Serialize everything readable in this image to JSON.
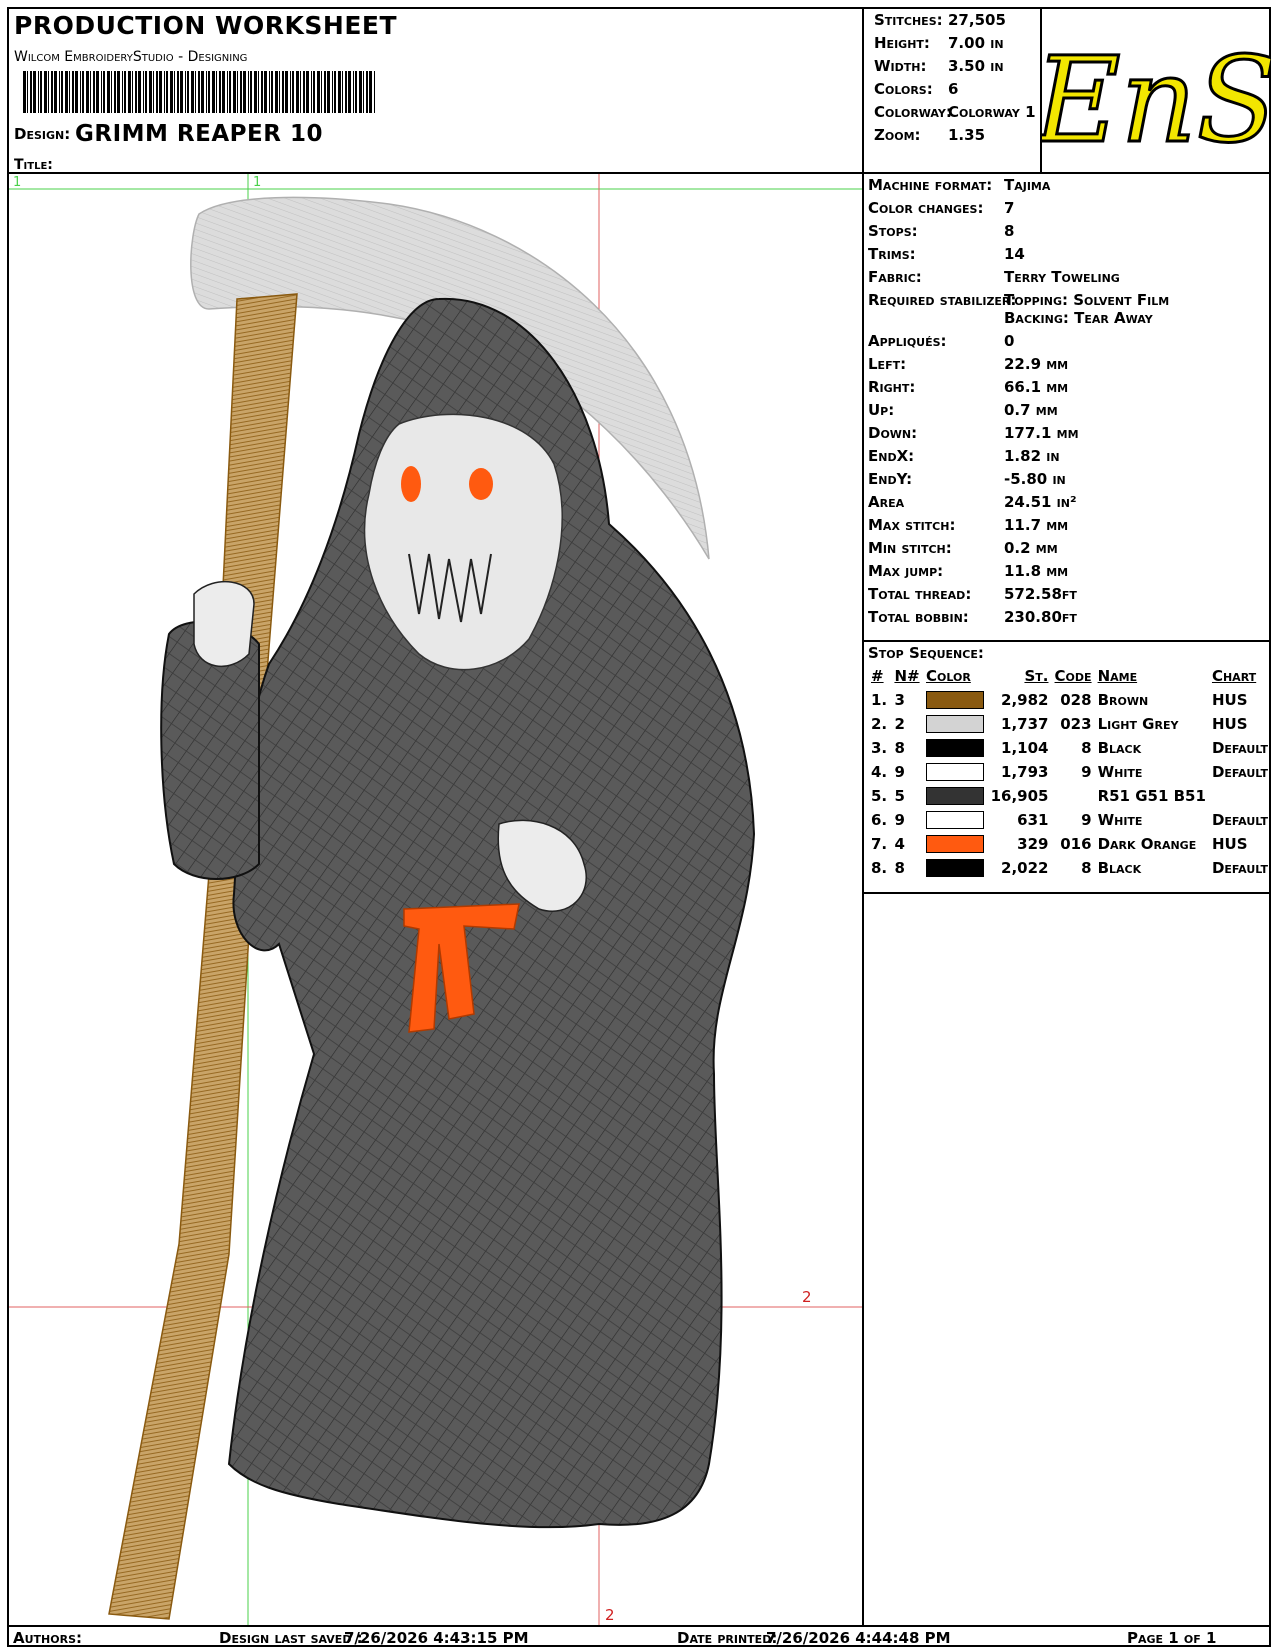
{
  "header": {
    "title": "PRODUCTION WORKSHEET",
    "subtitle": "Wilcom EmbroideryStudio - Designing",
    "design_label": "Design:",
    "design_value": "GRIMM REAPER  10",
    "title_label": "Title:"
  },
  "summary": {
    "stitches_label": "Stitches:",
    "stitches": "27,505",
    "height_label": "Height:",
    "height": "7.00 in",
    "width_label": "Width:",
    "width": "3.50 in",
    "colors_label": "Colors:",
    "colors": "6",
    "colorway_label": "Colorway:",
    "colorway": "Colorway 1",
    "zoom_label": "Zoom:",
    "zoom": "1.35"
  },
  "logo": {
    "text": "EnS",
    "color": "#f2e600"
  },
  "info": [
    {
      "label": "Machine format:",
      "value": "Tajima"
    },
    {
      "label": "Color changes:",
      "value": "7"
    },
    {
      "label": "Stops:",
      "value": "8"
    },
    {
      "label": "Trims:",
      "value": "14"
    },
    {
      "label": "Fabric:",
      "value": "Terry Toweling"
    },
    {
      "label": "Required stabilizer:",
      "value": "Topping: Solvent Film",
      "value2": "Backing: Tear Away"
    },
    {
      "label": "Appliqués:",
      "value": "0"
    },
    {
      "label": "Left:",
      "value": "22.9 mm"
    },
    {
      "label": "Right:",
      "value": "66.1 mm"
    },
    {
      "label": "Up:",
      "value": "0.7 mm"
    },
    {
      "label": "Down:",
      "value": "177.1 mm"
    },
    {
      "label": "EndX:",
      "value": "1.82 in"
    },
    {
      "label": "EndY:",
      "value": "-5.80 in"
    },
    {
      "label": "Area",
      "value": "24.51 in²"
    },
    {
      "label": "Max stitch:",
      "value": "11.7 mm"
    },
    {
      "label": "Min stitch:",
      "value": "0.2 mm"
    },
    {
      "label": "Max jump:",
      "value": "11.8 mm"
    },
    {
      "label": "Total thread:",
      "value": "572.58ft"
    },
    {
      "label": "Total bobbin:",
      "value": "230.80ft"
    }
  ],
  "stop_sequence": {
    "title": "Stop Sequence:",
    "headers": [
      "#",
      "N#",
      "Color",
      "St.",
      "Code",
      "Name",
      "Chart"
    ],
    "rows": [
      {
        "idx": "1.",
        "n": "3",
        "color": "#8a5a10",
        "st": "2,982",
        "code": "028",
        "name": "Brown",
        "chart": "HUS"
      },
      {
        "idx": "2.",
        "n": "2",
        "color": "#d3d3d3",
        "st": "1,737",
        "code": "023",
        "name": "Light Grey",
        "chart": "HUS"
      },
      {
        "idx": "3.",
        "n": "8",
        "color": "#000000",
        "st": "1,104",
        "code": "8",
        "name": "Black",
        "chart": "Default"
      },
      {
        "idx": "4.",
        "n": "9",
        "color": "#ffffff",
        "st": "1,793",
        "code": "9",
        "name": "White",
        "chart": "Default"
      },
      {
        "idx": "5.",
        "n": "5",
        "color": "#333333",
        "st": "16,905",
        "code": "",
        "name": "R51 G51 B51",
        "chart": ""
      },
      {
        "idx": "6.",
        "n": "9",
        "color": "#ffffff",
        "st": "631",
        "code": "9",
        "name": "White",
        "chart": "Default"
      },
      {
        "idx": "7.",
        "n": "4",
        "color": "#ff5a10",
        "st": "329",
        "code": "016",
        "name": "Dark Orange",
        "chart": "HUS"
      },
      {
        "idx": "8.",
        "n": "8",
        "color": "#000000",
        "st": "2,022",
        "code": "8",
        "name": "Black",
        "chart": "Default"
      }
    ]
  },
  "guides": {
    "marker_1": "1",
    "marker_2": "2"
  },
  "footer": {
    "authors_label": "Authors:",
    "saved_label": "Design last saved :",
    "saved_value": "7/26/2026 4:43:15 PM",
    "printed_label": "Date printed:",
    "printed_value": "7/26/2026 4:44:48 PM",
    "page_label": "Page 1 of 1"
  }
}
